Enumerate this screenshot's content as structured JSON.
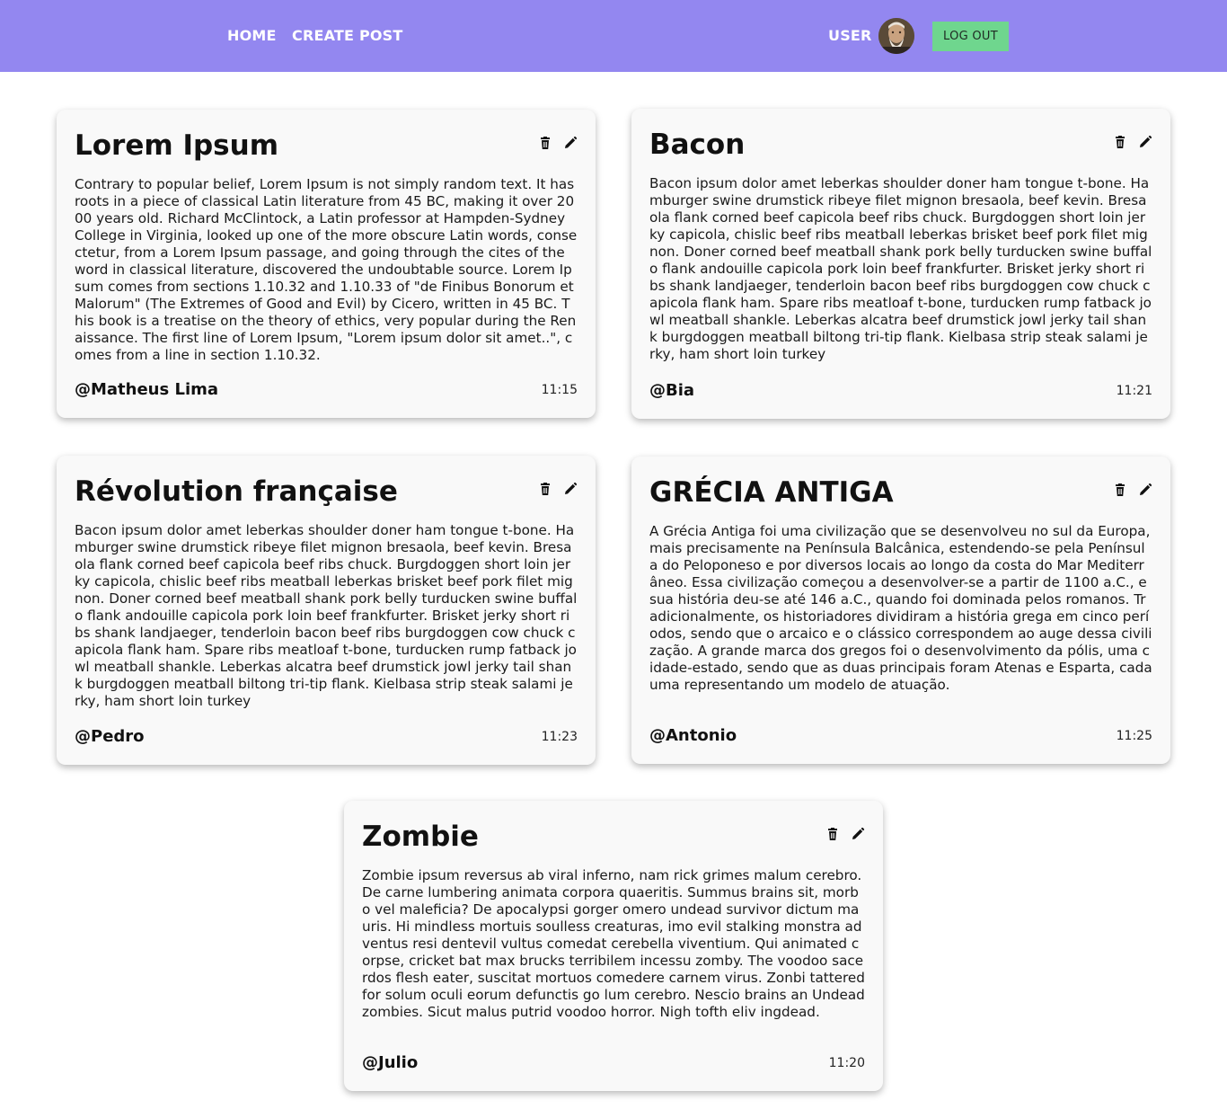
{
  "nav": {
    "home": "HOME",
    "create_post": "CREATE POST",
    "user": "USER",
    "logout": "LOG OUT"
  },
  "colors": {
    "navbar": "#9387f0",
    "logout_button": "#6fd68e",
    "card_background": "#f9f9f9"
  },
  "icons": {
    "delete": "trash-icon",
    "edit": "pencil-icon"
  },
  "posts": [
    {
      "title": "Lorem Ipsum",
      "body": "Contrary to popular belief, Lorem Ipsum is not simply random text. It has roots in a piece of classical Latin literature from 45 BC, making it over 2000 years old. Richard McClintock, a Latin professor at Hampden-Sydney College in Virginia, looked up one of the more obscure Latin words, consectetur, from a Lorem Ipsum passage, and going through the cites of the word in classical literature, discovered the undoubtable source. Lorem Ipsum comes from sections 1.10.32 and 1.10.33 of \"de Finibus Bonorum et Malorum\" (The Extremes of Good and Evil) by Cicero, written in 45 BC. This book is a treatise on the theory of ethics, very popular during the Renaissance. The first line of Lorem Ipsum, \"Lorem ipsum dolor sit amet..\", comes from a line in section 1.10.32.",
      "author": "@Matheus Lima",
      "time": "11:15"
    },
    {
      "title": "Bacon",
      "body": "Bacon ipsum dolor amet leberkas shoulder doner ham tongue t-bone. Hamburger swine drumstick ribeye filet mignon bresaola, beef kevin. Bresaola flank corned beef capicola beef ribs chuck. Burgdoggen short loin jerky capicola, chislic beef ribs meatball leberkas brisket beef pork filet mignon. Doner corned beef meatball shank pork belly turducken swine buffalo flank andouille capicola pork loin beef frankfurter. Brisket jerky short ribs shank landjaeger, tenderloin bacon beef ribs burgdoggen cow chuck capicola flank ham. Spare ribs meatloaf t-bone, turducken rump fatback jowl meatball shankle. Leberkas alcatra beef drumstick jowl jerky tail shank burgdoggen meatball biltong tri-tip flank. Kielbasa strip steak salami jerky, ham short loin turkey",
      "author": "@Bia",
      "time": "11:21"
    },
    {
      "title": "Révolution française",
      "body": "Bacon ipsum dolor amet leberkas shoulder doner ham tongue t-bone. Hamburger swine drumstick ribeye filet mignon bresaola, beef kevin. Bresaola flank corned beef capicola beef ribs chuck. Burgdoggen short loin jerky capicola, chislic beef ribs meatball leberkas brisket beef pork filet mignon. Doner corned beef meatball shank pork belly turducken swine buffalo flank andouille capicola pork loin beef frankfurter. Brisket jerky short ribs shank landjaeger, tenderloin bacon beef ribs burgdoggen cow chuck capicola flank ham. Spare ribs meatloaf t-bone, turducken rump fatback jowl meatball shankle. Leberkas alcatra beef drumstick jowl jerky tail shank burgdoggen meatball biltong tri-tip flank. Kielbasa strip steak salami jerky, ham short loin turkey",
      "author": "@Pedro",
      "time": "11:23"
    },
    {
      "title": "GRÉCIA ANTIGA",
      "body": "A Grécia Antiga foi uma civilização que se desenvolveu no sul da Europa, mais precisamente na Península Balcânica, estendendo-se pela Península do Peloponeso e por diversos locais ao longo da costa do Mar Mediterrâneo. Essa civilização começou a desenvolver-se a partir de 1100 a.C., e sua história deu-se até 146 a.C., quando foi dominada pelos romanos. Tradicionalmente, os historiadores dividiram a história grega em cinco períodos, sendo que o arcaico e o clássico correspondem ao auge dessa civilização. A grande marca dos gregos foi o desenvolvimento da pólis, uma cidade-estado, sendo que as duas principais foram Atenas e Esparta, cada uma representando um modelo de atuação.",
      "author": "@Antonio",
      "time": "11:25"
    },
    {
      "title": "Zombie",
      "body": "Zombie ipsum reversus ab viral inferno, nam rick grimes malum cerebro. De carne lumbering animata corpora quaeritis. Summus brains sit, morbo vel maleficia? De apocalypsi gorger omero undead survivor dictum mauris. Hi mindless mortuis soulless creaturas, imo evil stalking monstra adventus resi dentevil vultus comedat cerebella viventium. Qui animated corpse, cricket bat max brucks terribilem incessu zomby. The voodoo sacerdos flesh eater, suscitat mortuos comedere carnem virus. Zonbi tattered for solum oculi eorum defunctis go lum cerebro. Nescio brains an Undead zombies. Sicut malus putrid voodoo horror. Nigh tofth eliv ingdead.",
      "author": "@Julio",
      "time": "11:20"
    }
  ]
}
